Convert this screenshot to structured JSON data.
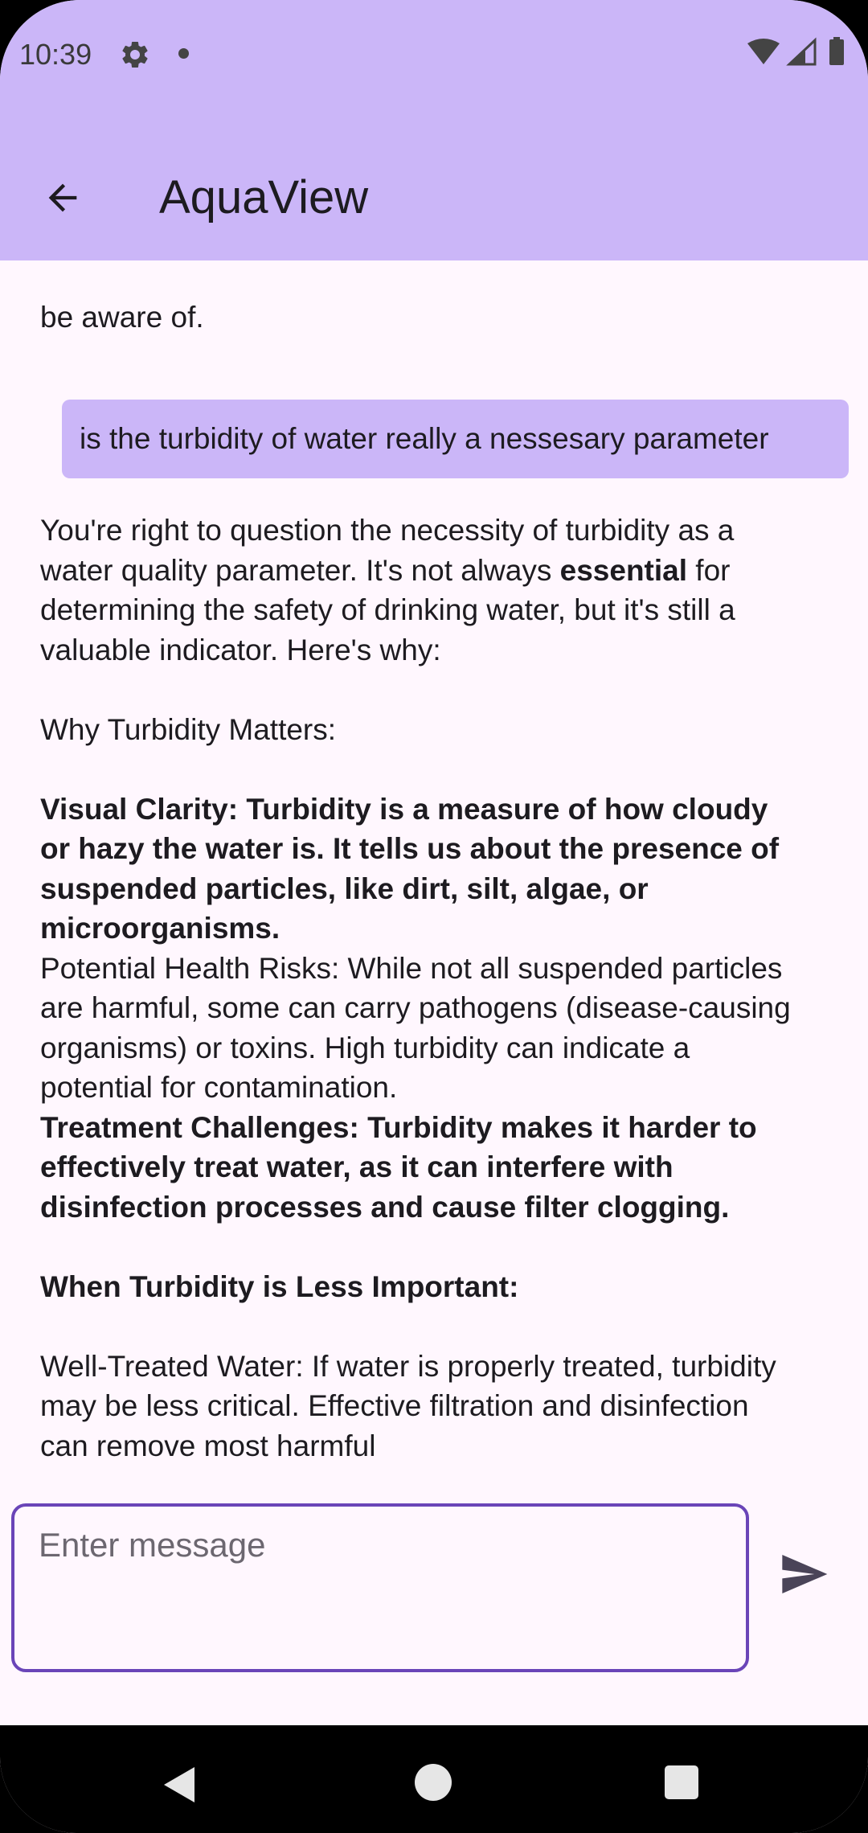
{
  "status_bar": {
    "time": "10:39",
    "icons_left": [
      "gear-icon",
      "notification-dot-icon"
    ],
    "icons_right": [
      "wifi-icon",
      "cellular-signal-icon",
      "battery-icon"
    ]
  },
  "app_bar": {
    "title": "AquaView",
    "back_icon": "arrow-back-icon"
  },
  "colors": {
    "app_bar_bg": "#CBB6F8",
    "user_bubble_bg": "#CBB6F8",
    "screen_bg": "#FFF7FE",
    "input_border": "#6A45B8",
    "nav_bar_bg": "#000000"
  },
  "chat": {
    "previous_tail": "be aware of.",
    "user_message": "is the turbidity of water really a nessesary parameter",
    "bot_response": {
      "intro_1": "You're right to question the necessity of turbidity as a water quality parameter. It's not always ",
      "intro_bold": "essential",
      "intro_2": " for determining the safety of drinking water, but it's still a valuable indicator. Here's why:",
      "heading_1": "Why Turbidity Matters:",
      "point_1": " Visual Clarity: Turbidity is a measure of how cloudy or hazy the water is.  It tells us about the presence of suspended particles, like dirt, silt, algae, or microorganisms.",
      "point_2": " Potential Health Risks:  While not all suspended particles are harmful, some can carry pathogens (disease-causing organisms) or toxins. High turbidity can indicate a potential for contamination.",
      "point_3": " Treatment Challenges: Turbidity makes it harder to effectively treat water, as it can interfere with disinfection processes and cause filter clogging.",
      "heading_2": "When Turbidity is Less Important:",
      "point_4": " Well-Treated Water: If water is properly treated, turbidity may be less critical. Effective filtration and disinfection can remove most harmful"
    }
  },
  "input": {
    "placeholder": "Enter message",
    "value": "",
    "send_icon": "send-icon"
  },
  "nav_bar": {
    "icons": [
      "nav-back-icon",
      "nav-home-icon",
      "nav-recents-icon"
    ]
  }
}
